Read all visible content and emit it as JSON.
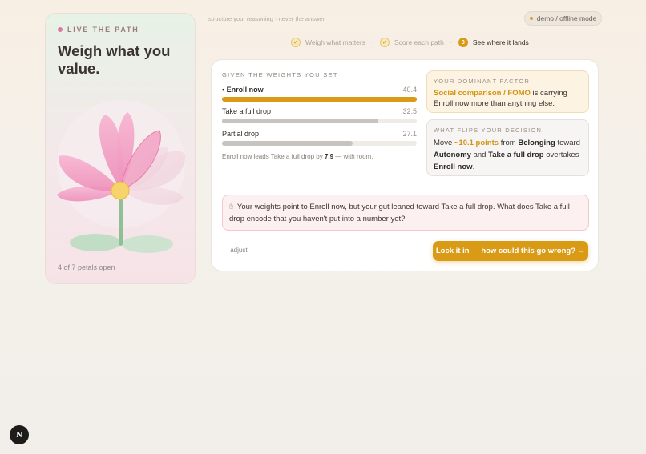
{
  "sidebar": {
    "eyebrow": "LIVE THE PATH",
    "title": "Weigh what you value.",
    "petals_status": "4 of 7 petals open",
    "petals_open": 4,
    "petals_total": 7
  },
  "header": {
    "tagline": "structure your reasoning · never the answer",
    "mode_badge": "demo / offline mode"
  },
  "steps": [
    {
      "number": "1",
      "label": "Weigh what matters",
      "state": "done"
    },
    {
      "number": "2",
      "label": "Score each path",
      "state": "done"
    },
    {
      "number": "3",
      "label": "See where it lands",
      "state": "current"
    }
  ],
  "weights": {
    "heading": "GIVEN THE WEIGHTS YOU SET",
    "rows": [
      {
        "name": "• Enroll now",
        "score": "40.4",
        "value": 40.4
      },
      {
        "name": "Take a full drop",
        "score": "32.5",
        "value": 32.5
      },
      {
        "name": "Partial drop",
        "score": "27.1",
        "value": 27.1
      }
    ],
    "lead_note_prefix": "Enroll now leads Take a full drop by",
    "lead_margin": "7.9",
    "lead_note_suffix": "— with room."
  },
  "dominant_factor": {
    "eyebrow": "YOUR DOMINANT FACTOR",
    "factor": "Social comparison / FOMO",
    "text": "is carrying Enroll now more than anything else."
  },
  "flip": {
    "eyebrow": "WHAT FLIPS YOUR DECISION",
    "move": "Move",
    "points": "~10.1 points",
    "from": "from",
    "source_factor": "Belonging",
    "toward": "toward",
    "target_factor": "Autonomy",
    "and": "and",
    "option_up": "Take a full drop",
    "overtakes": "overtakes",
    "option_down": "Enroll now",
    "end": "."
  },
  "gut_check": {
    "icon": "hand-icon",
    "text": "Your weights point to Enroll now, but your gut leaned toward Take a full drop. What does Take a full drop encode that you haven't put into a number yet?"
  },
  "actions": {
    "adjust": "← adjust",
    "lock": "Lock it in — how could this go wrong? →"
  },
  "footer": {
    "badge": "N"
  },
  "colors": {
    "accent": "#d99a16",
    "petal": "#f0a6c6",
    "stem": "#8fbf94",
    "center": "#f6d36b"
  }
}
